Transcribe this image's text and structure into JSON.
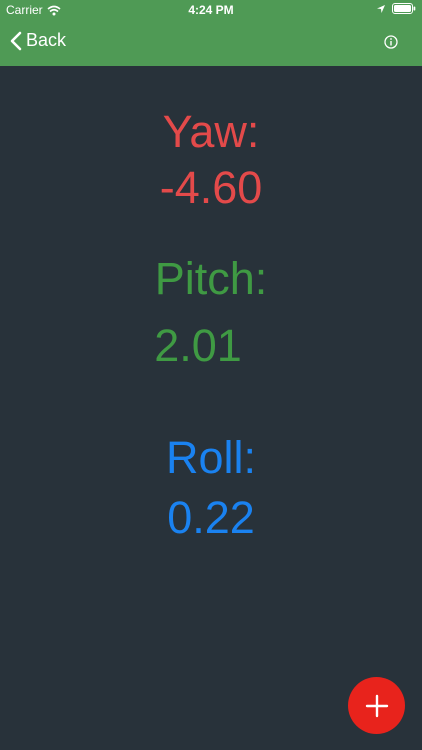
{
  "status_bar": {
    "carrier": "Carrier",
    "time": "4:24 PM"
  },
  "nav": {
    "back_label": "Back"
  },
  "readings": {
    "yaw": {
      "label": "Yaw:",
      "value": "-4.60"
    },
    "pitch": {
      "label": "Pitch:",
      "value": "2.01"
    },
    "roll": {
      "label": "Roll:",
      "value": "0.22"
    }
  },
  "colors": {
    "yaw": "#e34a4a",
    "pitch": "#3f9a43",
    "roll": "#1a82f0",
    "nav_bg": "#4f9a55",
    "background": "#28323a",
    "fab": "#e8231c"
  },
  "icons": {
    "wifi": "wifi-icon",
    "location": "location-arrow-icon",
    "battery": "battery-icon",
    "back": "chevron-left-icon",
    "info": "info-circle-icon",
    "add": "plus-icon"
  }
}
